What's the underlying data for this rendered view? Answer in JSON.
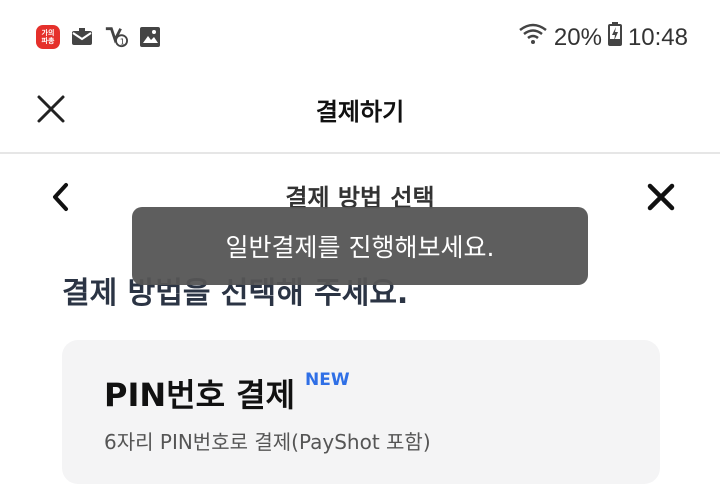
{
  "status_bar": {
    "app_badge_text": "가의\n파총",
    "battery": "20%",
    "time": "10:48",
    "icons": [
      "app-badge-icon",
      "mail-icon",
      "call-missed-icon",
      "image-icon",
      "wifi-icon",
      "battery-charging-icon"
    ]
  },
  "header": {
    "title": "결제하기",
    "close_icon": "close-icon"
  },
  "subheader": {
    "title": "결제 방법 선택",
    "back_icon": "chevron-left-icon",
    "close_icon": "close-icon"
  },
  "main": {
    "heading": "결제 방법을 선택해 주세요."
  },
  "payment_options": [
    {
      "title": "PIN번호 결제",
      "badge": "NEW",
      "subtitle": "6자리 PIN번호로 결제(PayShot 포함)"
    }
  ],
  "toast": {
    "message": "일반결제를 진행해보세요."
  },
  "colors": {
    "badge_new": "#2f6fe6",
    "heading": "#2b3444",
    "card_bg": "#f4f4f5",
    "toast_bg": "#555555"
  }
}
